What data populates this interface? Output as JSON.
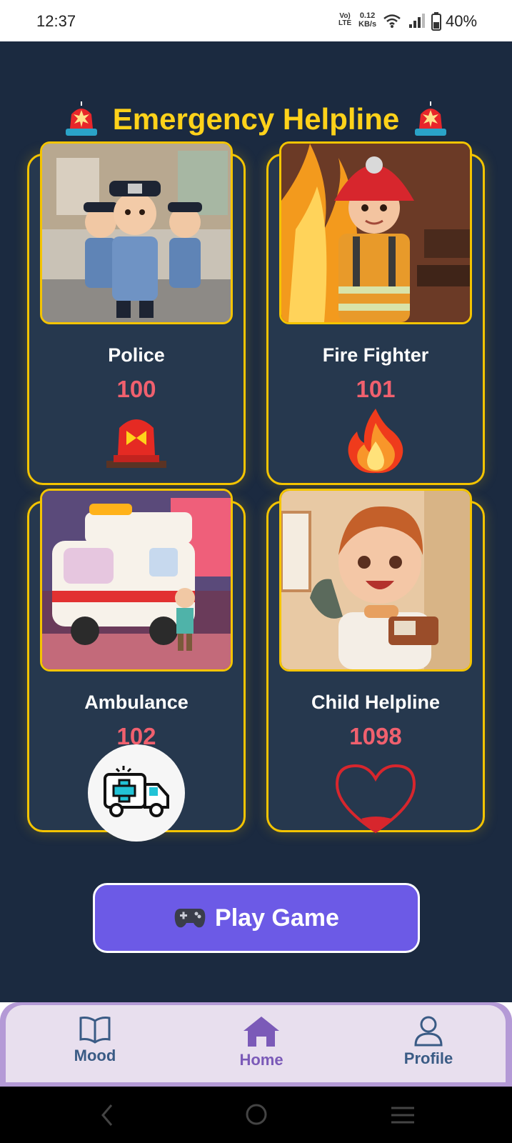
{
  "status_bar": {
    "time": "12:37",
    "volte_line1": "Vo)",
    "volte_line2": "LTE",
    "speed_value": "0.12",
    "speed_unit": "KB/s",
    "battery": "40%"
  },
  "header": {
    "title": "Emergency Helpline",
    "icon": "siren-icon"
  },
  "helplines": [
    {
      "name": "Police",
      "number": "100",
      "icon": "police-siren-icon"
    },
    {
      "name": "Fire Fighter",
      "number": "101",
      "icon": "fire-icon"
    },
    {
      "name": "Ambulance",
      "number": "102",
      "icon": "ambulance-icon"
    },
    {
      "name": "Child Helpline",
      "number": "1098",
      "icon": "heart-icon"
    }
  ],
  "play_button": {
    "icon": "gamepad-icon",
    "label": "Play Game"
  },
  "nav": {
    "items": [
      {
        "label": "Mood",
        "icon": "book-icon",
        "active": false
      },
      {
        "label": "Home",
        "icon": "home-icon",
        "active": true
      },
      {
        "label": "Profile",
        "icon": "person-icon",
        "active": false
      }
    ]
  },
  "colors": {
    "background": "#1b2a40",
    "card": "#26384e",
    "accent_yellow": "#f4c400",
    "number_red": "#f0606e",
    "button_purple": "#6c5ae6",
    "nav_active": "#7b5ab8",
    "nav_inactive": "#3a5b85"
  }
}
